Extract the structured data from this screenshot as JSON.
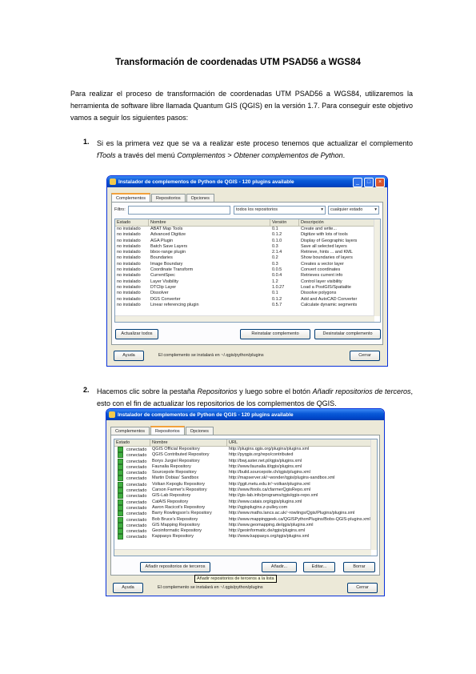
{
  "title": "Transformación de coordenadas UTM  PSAD56 a WGS84",
  "intro": "Para realizar el proceso de transformación de coordenadas UTM PSAD56 a WGS84, utilizaremos la herramienta de software libre llamada Quantum GIS (QGIS) en la versión 1.7. Para conseguir este objetivo vamos a seguir los siguientes pasos:",
  "step1": {
    "num": "1.",
    "t1": "Si es la primera vez que se va a realizar este proceso tenemos que actualizar el complemento ",
    "em1": "fTools",
    "t2": " a través del menú ",
    "em2": "Complementos > Obtener complementos de Python",
    "t3": "."
  },
  "step2": {
    "num": "2.",
    "t1": "Hacemos clic sobre la pestaña ",
    "em1": "Repositorios",
    "t2": " y luego sobre el botón ",
    "em2": "Añadir repositorios de terceros",
    "t3": ", esto con el fin de actualizar los repositorios de los complementos de QGIS."
  },
  "window_title": "Instalador de complementos de Python de QGIS - 120 plugins available",
  "tabs": [
    "Complementos",
    "Repositorios",
    "Opciones"
  ],
  "win1": {
    "filter_label": "Filtro:",
    "repo_select": "todos los repositorios",
    "state_select": "cualquier estado",
    "columns": [
      "Estado",
      "Nombre",
      "Versión",
      "Descripción"
    ],
    "rows": [
      [
        "no instalado",
        "ABAT Map Tools",
        "0.1",
        "Create and write..."
      ],
      [
        "no instalado",
        "Advanced Digitize",
        "0.1.2",
        "Digitize with lots of tools"
      ],
      [
        "no instalado",
        "AGA Plugin",
        "0.1.0",
        "Display of Geographic layers"
      ],
      [
        "no instalado",
        "Batch Save Layers",
        "0.3",
        "Save all selected layers"
      ],
      [
        "no instalado",
        "bbox-range plugin",
        "2.1.4",
        "Retrieve, hints ... and KML"
      ],
      [
        "no instalado",
        "Boundaries",
        "0.2",
        "Show boundaries of layers"
      ],
      [
        "no instalado",
        "Image Boundary",
        "0.3",
        "Creates a vector layer"
      ],
      [
        "no instalado",
        "Coordinate Transform",
        "0.0.5",
        "Convert coordinates"
      ],
      [
        "no instalado",
        "CurrentSpec",
        "0.0.4",
        "Retrieves current info"
      ],
      [
        "no instalado",
        "Layer Visibility",
        "1.2",
        "Control layer visibility"
      ],
      [
        "no instalado",
        "DTClip Layer",
        "1.0.27",
        "Load a PostGIS/Spatialite"
      ],
      [
        "no instalado",
        "Dissolver",
        "0.1",
        "Dissolve polygons"
      ],
      [
        "no instalado",
        "DGS Converter",
        "0.1.2",
        "Add and AutoCAD Converter"
      ],
      [
        "no instalado",
        "Linear referencing plugin",
        "0.5.7",
        "Calculate dynamic segments"
      ]
    ],
    "btn_update": "Actualizar todos",
    "btn_reinstall": "Reinstalar complemento",
    "btn_uninstall": "Desinstalar complemento",
    "btn_help": "Ayuda",
    "status": "El complemento se instalará en ~/.qgis/python/plugins",
    "btn_close": "Cerrar"
  },
  "win2": {
    "columns": [
      "Estado",
      "Nombre",
      "URL"
    ],
    "rows": [
      [
        "conectado",
        "QGIS Official Repository",
        "http://plugins.qgis.org/plugins/plugins.xml"
      ],
      [
        "conectado",
        "QGIS Contributed Repository",
        "http://pyqgis.org/repo/contributed"
      ],
      [
        "conectado",
        "Borys Jurgiel Repository",
        "http://bwj.aster.net.pl/qgis/plugins.xml"
      ],
      [
        "conectado",
        "Faunalia Repository",
        "http://www.faunalia.it/qgis/plugins.xml"
      ],
      [
        "conectado",
        "Sourcepole Repository",
        "http://build.sourcepole.ch/qgis/plugins.xml"
      ],
      [
        "conectado",
        "Martin Dobias' Sandbox",
        "http://mapserver.sk/~wonder/qgis/plugins-sandbox.xml"
      ],
      [
        "conectado",
        "Volkan Kepoglu Repository",
        "http://ggit.metu.edu.tr/~volkan/plugins.xml"
      ],
      [
        "conectado",
        "Carson Farmer's Repository",
        "http://www.ftools.ca/cfarmerQgisRepo.xml"
      ],
      [
        "conectado",
        "GIS-Lab Repository",
        "http://gis-lab.info/programs/qgis/qgis-repo.xml"
      ],
      [
        "conectado",
        "CatAIS Repository",
        "http://www.catais.org/qgis/plugins.xml"
      ],
      [
        "conectado",
        "Aaron Racicot's Repository",
        "http://qgisplugins.z-pulley.com"
      ],
      [
        "conectado",
        "Barry Rowlingson's Repository",
        "http://www.maths.lancs.ac.uk/~rowlings/Qgis/Plugins/plugins.xml"
      ],
      [
        "conectado",
        "Bob Bruce's Repository",
        "http://www.mappinggeek.ca/QGISPythonPlugins/Bobs-QGIS-plugins.xml"
      ],
      [
        "conectado",
        "GIS Mapping Repository",
        "http://www.geomapping.de/qgis/plugins.xml"
      ],
      [
        "conectado",
        "Geoinformatic Repository",
        "http://geoinformatic.de/qgis/plugins.xml"
      ],
      [
        "conectado",
        "Kappasys Repository",
        "http://www.kappasys.org/qgis/plugins.xml"
      ]
    ],
    "btn_add": "Añadir repositorios de terceros",
    "btn_add_new": "Añadir...",
    "btn_edit": "Editar...",
    "btn_delete": "Borrar",
    "tooltip": "Añadir repositorios de terceros a la lista",
    "btn_help": "Ayuda",
    "status": "El complemento se instalará en ~/.qgis/python/plugins",
    "btn_close": "Cerrar"
  }
}
